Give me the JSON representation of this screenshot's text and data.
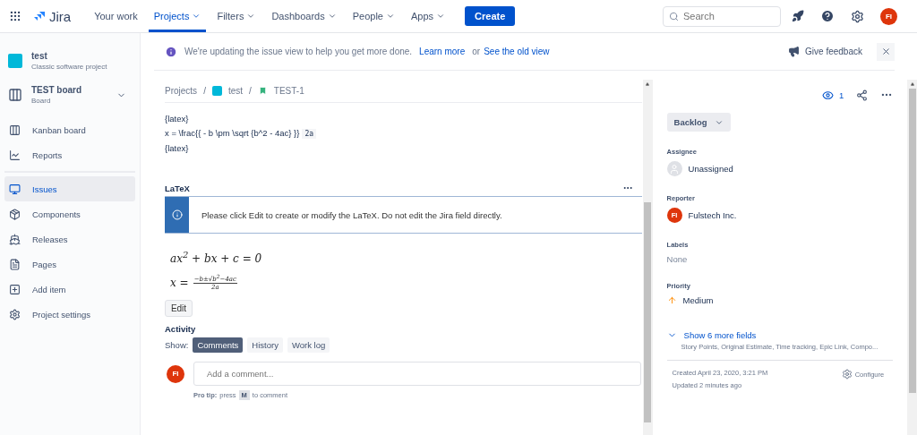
{
  "nav": {
    "logo": "Jira",
    "items": [
      {
        "label": "Your work",
        "selected": false,
        "dropdown": false
      },
      {
        "label": "Projects",
        "selected": true,
        "dropdown": true
      },
      {
        "label": "Filters",
        "selected": false,
        "dropdown": true
      },
      {
        "label": "Dashboards",
        "selected": false,
        "dropdown": true
      },
      {
        "label": "People",
        "selected": false,
        "dropdown": true
      },
      {
        "label": "Apps",
        "selected": false,
        "dropdown": true
      }
    ],
    "create": "Create",
    "search": {
      "placeholder": "Search"
    },
    "avatar": "FI"
  },
  "sidebar": {
    "project": {
      "name": "test",
      "type": "Classic software project"
    },
    "board": {
      "name": "TEST board",
      "type": "Board"
    },
    "groups": [
      [
        {
          "label": "Kanban board",
          "selected": false
        },
        {
          "label": "Reports",
          "selected": false
        }
      ],
      [
        {
          "label": "Issues",
          "selected": true
        },
        {
          "label": "Components",
          "selected": false
        },
        {
          "label": "Releases",
          "selected": false
        },
        {
          "label": "Pages",
          "selected": false
        },
        {
          "label": "Add item",
          "selected": false
        },
        {
          "label": "Project settings",
          "selected": false
        }
      ]
    ]
  },
  "banner": {
    "text": "We're updating the issue view to help you get more done.",
    "link1": "Learn more",
    "joiner": "or",
    "link2": "See the old view",
    "feedback": "Give feedback"
  },
  "breadcrumb": [
    "Projects",
    "test",
    "TEST-1"
  ],
  "breadcrumb_separator": "/",
  "description": {
    "lines": [
      "{latex}",
      "x = \\frac{{ - b \\pm \\sqrt {b^2 - 4ac} }}",
      "{latex}"
    ],
    "inline_code": "2a"
  },
  "latex": {
    "title": "LaTeX",
    "info": "Please click Edit to create or modify the LaTeX. Do not edit the Jira field directly.",
    "formula1": "ax$^{2}$ + bx + c = 0",
    "formula2": {
      "lhs": "x =",
      "numerator": "−b±√b$^{2}$−4ac",
      "denominator": "2a"
    },
    "edit": "Edit"
  },
  "activity": {
    "title": "Activity",
    "show": "Show:",
    "tabs": [
      {
        "label": "Comments",
        "selected": true
      },
      {
        "label": "History",
        "selected": false
      },
      {
        "label": "Work log",
        "selected": false
      }
    ],
    "avatar": "FI",
    "comment_placeholder": "Add a comment...",
    "tip_label": "Pro tip:",
    "tip_pre": "press",
    "tip_key": "M",
    "tip_post": "to comment"
  },
  "details": {
    "watchers": "1",
    "status": "Backlog",
    "fields": [
      {
        "label": "Assignee",
        "value": "Unassigned",
        "kind": "empty-user"
      },
      {
        "label": "Reporter",
        "value": "Fulstech Inc.",
        "kind": "user",
        "avatar": "FI"
      },
      {
        "label": "Labels",
        "value": "None",
        "kind": "none"
      },
      {
        "label": "Priority",
        "value": "Medium",
        "kind": "priority"
      }
    ],
    "more": "Show 6 more fields",
    "more_list": "Story Points, Original Estimate, Time tracking, Epic Link, Compo...",
    "created": "Created April 23, 2020, 3:21 PM",
    "updated": "Updated 2 minutes ago",
    "configure": "Configure"
  }
}
